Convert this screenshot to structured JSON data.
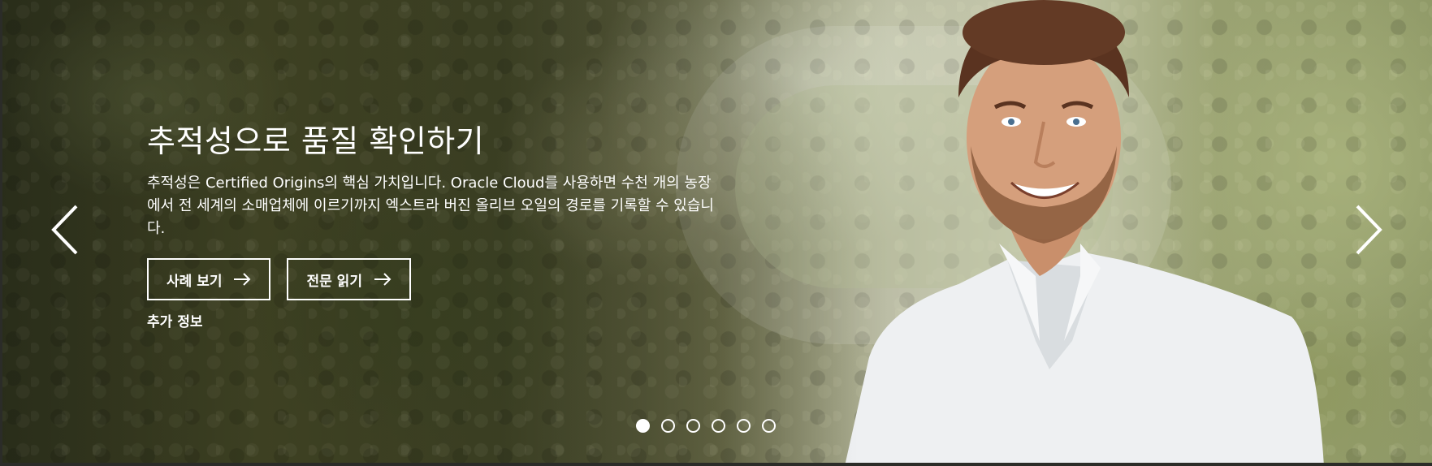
{
  "hero": {
    "title": "추적성으로 품질 확인하기",
    "description": "추적성은 Certified Origins의 핵심 가치입니다. Oracle Cloud를 사용하면 수천 개의 농장에서 전 세계의 소매업체에 이르기까지 엑스트라 버진 올리브 오일의 경로를 기록할 수 있습니다.",
    "buttons": [
      {
        "label": "사례 보기",
        "icon": "arrow-right-icon"
      },
      {
        "label": "전문 읽기",
        "icon": "arrow-right-icon"
      }
    ],
    "more_link": "추가 정보"
  },
  "carousel": {
    "prev_icon": "chevron-left-icon",
    "next_icon": "chevron-right-icon",
    "slide_count": 6,
    "active_index": 0
  },
  "colors": {
    "text": "#ffffff",
    "border": "#ffffff"
  }
}
